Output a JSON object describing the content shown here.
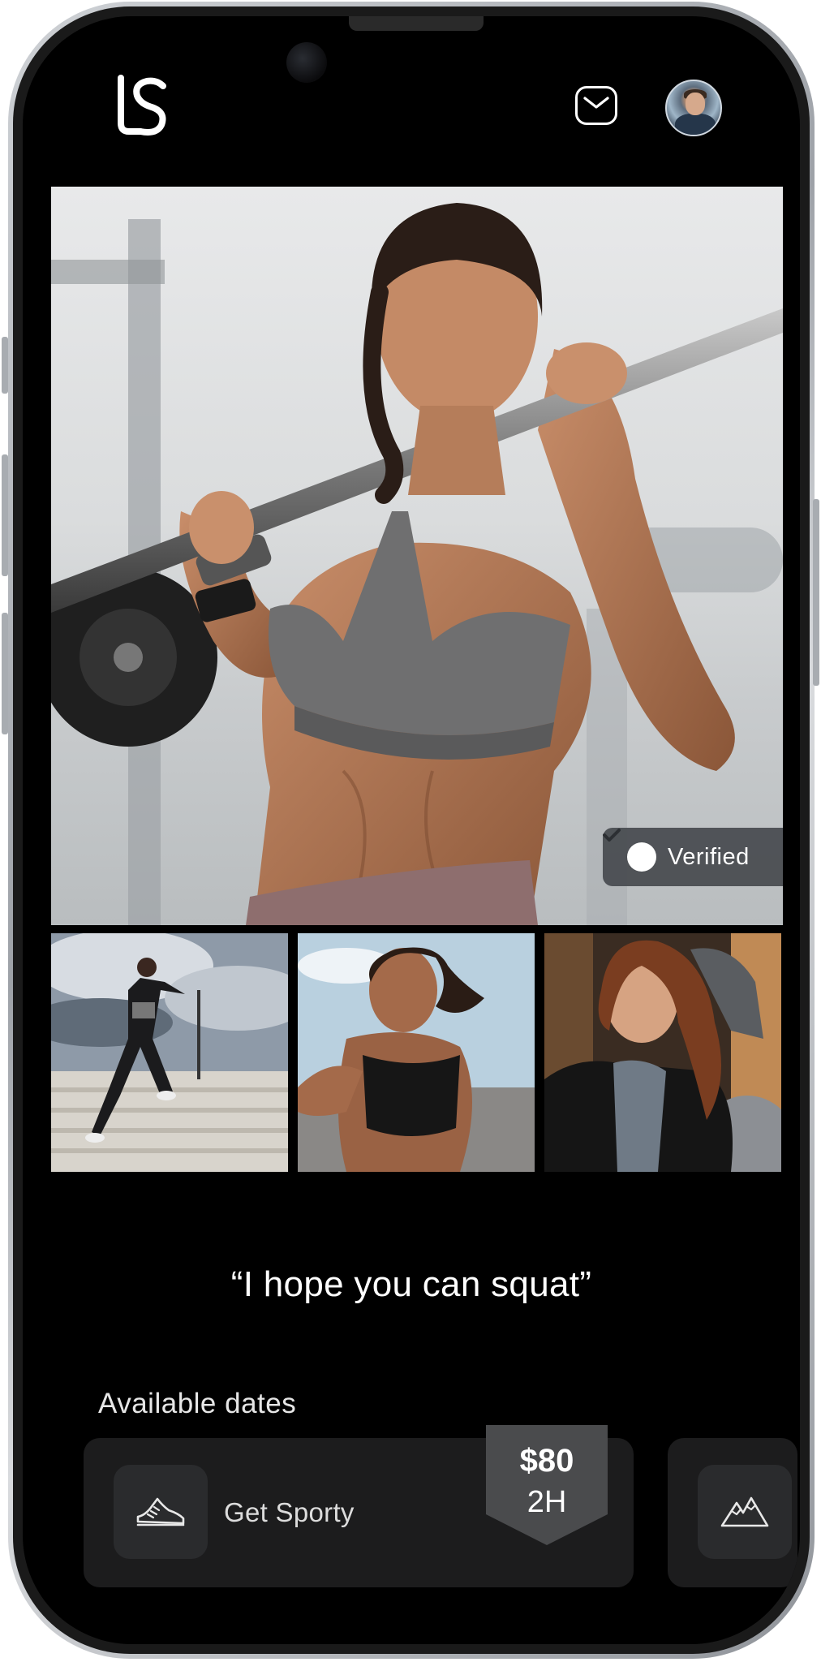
{
  "app": {
    "logo_text": "LS"
  },
  "header": {
    "mail_icon": "mail-icon",
    "avatar_icon": "user-avatar"
  },
  "profile": {
    "verified_label": "Verified",
    "quote": "“I hope you can squat”"
  },
  "dates": {
    "title": "Available dates",
    "cards": [
      {
        "icon": "sneaker-icon",
        "name": "Get Sporty",
        "price": "$80",
        "duration": "2H"
      },
      {
        "icon": "mountain-icon",
        "name": "",
        "price": "",
        "duration": ""
      }
    ]
  },
  "colors": {
    "background": "#000000",
    "card": "#1c1c1d",
    "icon_box": "#2a2b2d",
    "badge": "#464a4e",
    "price_tag": "#4a4b4d"
  }
}
